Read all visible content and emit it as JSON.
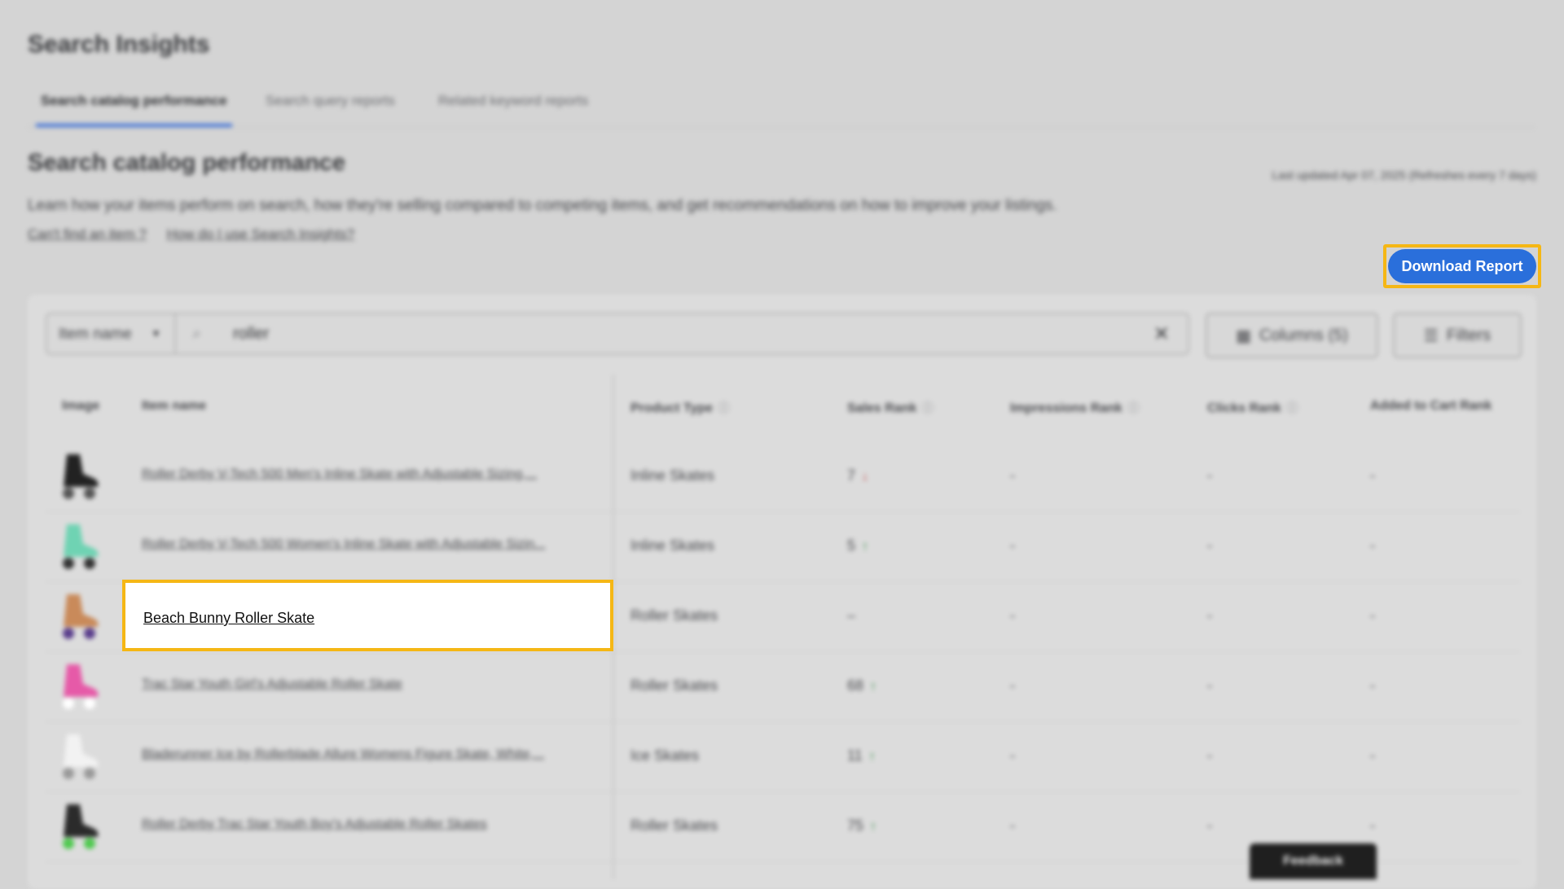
{
  "page": {
    "title": "Search Insights"
  },
  "tabs": [
    {
      "label": "Search catalog performance",
      "active": true
    },
    {
      "label": "Search query reports",
      "active": false
    },
    {
      "label": "Related keyword reports",
      "active": false
    }
  ],
  "section": {
    "title": "Search catalog performance",
    "last_updated": "Last updated Apr 07, 2025 (Refreshes every 7 days)",
    "description": "Learn how your items perform on search, how they're selling compared to competing items, and get recommendations on how to improve your listings.",
    "links": [
      "Can't find an item ?",
      "How do I use Search Insights?"
    ]
  },
  "download_button": "Download Report",
  "filter": {
    "select_value": "Item name",
    "search_value": "roller",
    "columns_label": "Columns (5)",
    "filters_label": "Filters"
  },
  "table": {
    "headers": [
      "Image",
      "Item name",
      "Product Type",
      "Sales Rank",
      "Impressions Rank",
      "Clicks Rank",
      "Added to Cart Rank"
    ],
    "rows": [
      {
        "name": "Roller Derby V-Tech 500 Men's Inline Skate with Adjustable Sizing,...",
        "type": "Inline Skates",
        "sales_rank": "7",
        "trend": "down",
        "impressions": "-",
        "clicks": "-",
        "cart": "-",
        "colors": [
          "#222222",
          "#555555"
        ]
      },
      {
        "name": "Roller Derby V-Tech 500 Women's Inline Skate with Adjustable Sizin...",
        "type": "Inline Skates",
        "sales_rank": "5",
        "trend": "up",
        "impressions": "-",
        "clicks": "-",
        "cart": "-",
        "colors": [
          "#6fd3b3",
          "#333333"
        ]
      },
      {
        "name": "Beach Bunny Roller Skate",
        "type": "Roller Skates",
        "sales_rank": "–",
        "trend": "",
        "impressions": "-",
        "clicks": "-",
        "cart": "-",
        "colors": [
          "#c98a5a",
          "#5a3e8c"
        ]
      },
      {
        "name": "Trac Star Youth Girl's Adjustable Roller Skate",
        "type": "Roller Skates",
        "sales_rank": "68",
        "trend": "up",
        "impressions": "-",
        "clicks": "-",
        "cart": "-",
        "colors": [
          "#e65aa8",
          "#ffffff"
        ]
      },
      {
        "name": "Bladerunner Ice by Rollerblade Allure Womens Figure Skate, White,...",
        "type": "Ice Skates",
        "sales_rank": "11",
        "trend": "up",
        "impressions": "-",
        "clicks": "-",
        "cart": "-",
        "colors": [
          "#f2f2f2",
          "#999999"
        ]
      },
      {
        "name": "Roller Derby Trac Star Youth Boy's Adjustable Roller Skates",
        "type": "Roller Skates",
        "sales_rank": "75",
        "trend": "up",
        "impressions": "-",
        "clicks": "-",
        "cart": "-",
        "colors": [
          "#2b2b2b",
          "#4fc94f"
        ]
      }
    ]
  },
  "highlight_text": "Beach Bunny Roller Skate",
  "feedback_label": "Feedback",
  "colors": {
    "accent": "#2a6fdb",
    "highlight": "#f5b715",
    "up": "#2a8a3e",
    "down": "#c23a3a"
  }
}
